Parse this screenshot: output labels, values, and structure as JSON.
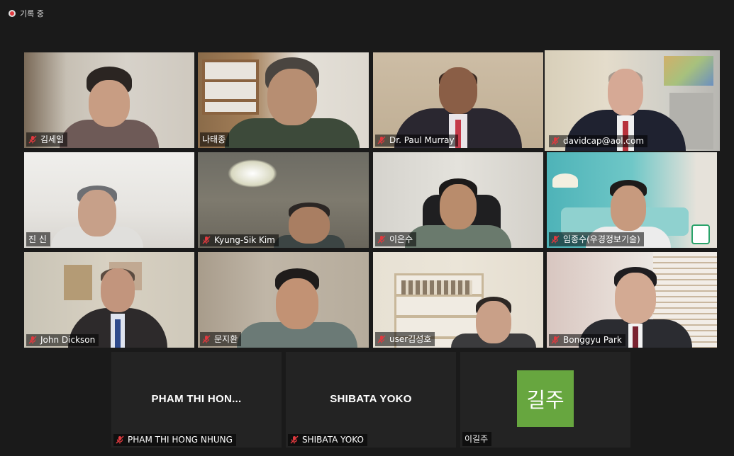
{
  "recording": {
    "label": "기록 중"
  },
  "colors": {
    "active_border": "#d6e05a",
    "recording_dot": "#e0393e",
    "avatar_bg": "#67a63f"
  },
  "participants": [
    {
      "name": "김세일",
      "muted": true
    },
    {
      "name": "나태종",
      "muted": false
    },
    {
      "name": "Dr. Paul Murray",
      "muted": true
    },
    {
      "name": "davidcap@aol.com",
      "muted": true,
      "active_speaker": true
    },
    {
      "name": "진 신",
      "muted": false
    },
    {
      "name": "Kyung-Sik Kim",
      "muted": true
    },
    {
      "name": "이은수",
      "muted": true
    },
    {
      "name": "임종수(우경정보기술)",
      "muted": true
    },
    {
      "name": "John Dickson",
      "muted": true
    },
    {
      "name": "문지환",
      "muted": true
    },
    {
      "name": "user김성호",
      "muted": true
    },
    {
      "name": "Bonggyu Park",
      "muted": true
    },
    {
      "name": "PHAM THI HONG NHUNG",
      "display": "PHAM THI HON...",
      "muted": true,
      "video": false
    },
    {
      "name": "SHIBATA YOKO",
      "display": "SHIBATA YOKO",
      "muted": true,
      "video": false
    },
    {
      "name": "이길주",
      "avatar": "길주",
      "muted": false,
      "video": false
    }
  ]
}
